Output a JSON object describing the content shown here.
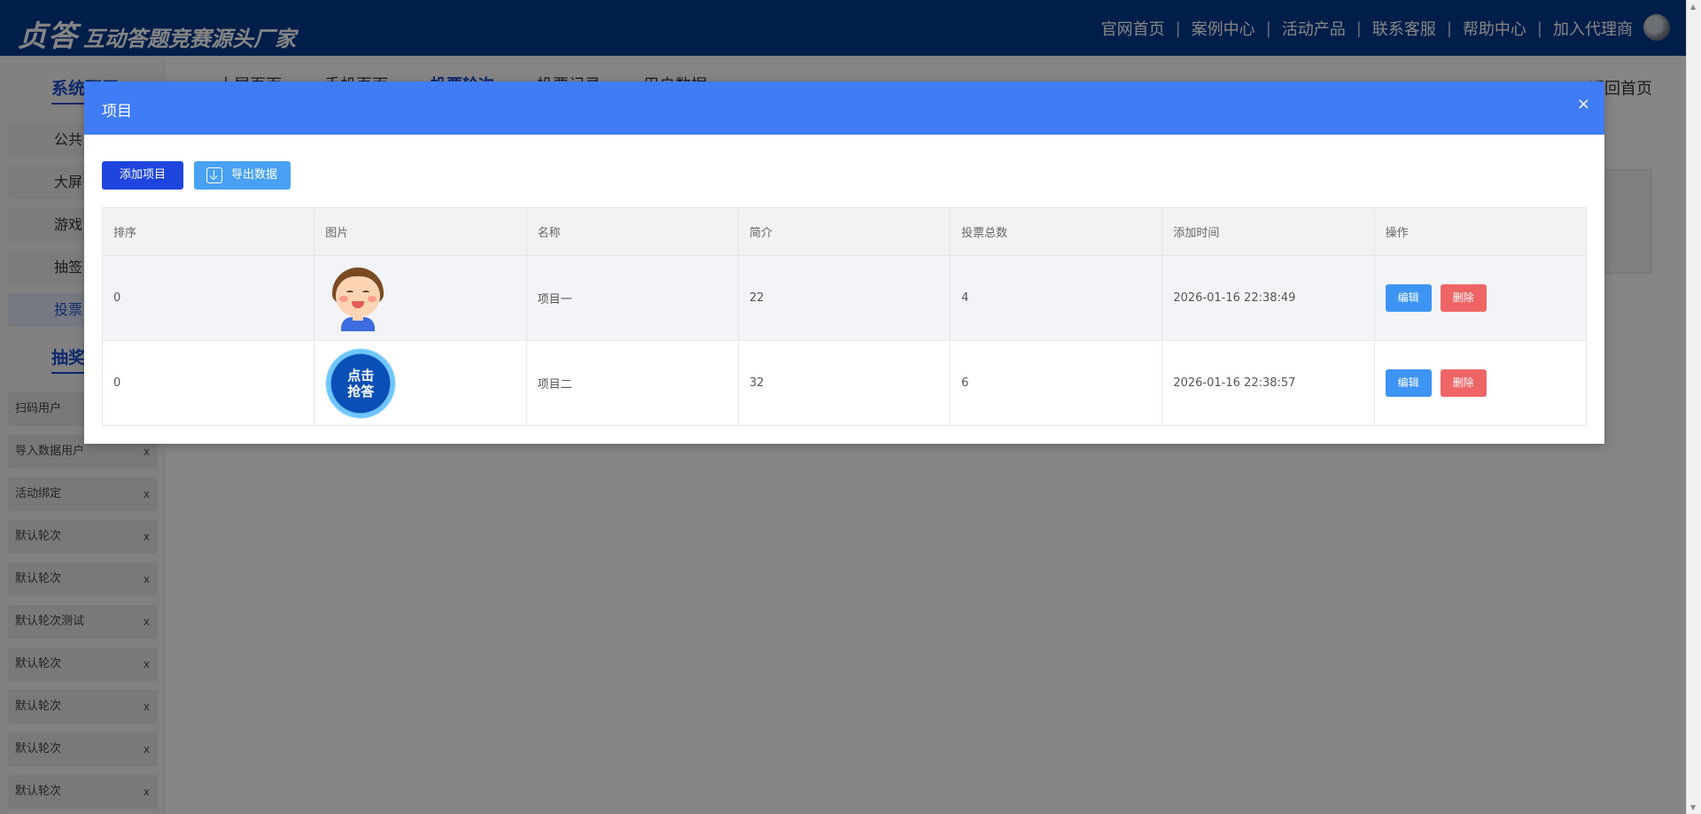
{
  "header": {
    "logo_main": "贞答",
    "logo_sub": "互动答题竞赛源头厂家",
    "nav": [
      "官网首页",
      "案例中心",
      "活动产品",
      "联系客服",
      "帮助中心",
      "加入代理商"
    ],
    "nav_separator": "|"
  },
  "sidebar": {
    "section1_title": "系统配置",
    "menu": [
      "公共",
      "大屏",
      "游戏",
      "抽签",
      "投票"
    ],
    "section2_title": "抽奖",
    "sub_items": [
      {
        "label": "扫码用户",
        "close": ""
      },
      {
        "label": "导入数据用户",
        "close": "x"
      },
      {
        "label": "活动绑定",
        "close": "x"
      },
      {
        "label": "默认轮次",
        "close": "x"
      },
      {
        "label": "默认轮次",
        "close": "x"
      },
      {
        "label": "默认轮次测试",
        "close": "x"
      },
      {
        "label": "默认轮次",
        "close": "x"
      },
      {
        "label": "默认轮次",
        "close": "x"
      },
      {
        "label": "默认轮次",
        "close": "x"
      },
      {
        "label": "默认轮次",
        "close": "x"
      }
    ]
  },
  "main": {
    "tabs": [
      "大屏页面",
      "手机页面",
      "投票轮次",
      "投票记录",
      "用户数据"
    ],
    "back_home": "返回首页"
  },
  "modal": {
    "title": "项目",
    "close": "×",
    "add_button": "添加项目",
    "export_button": "导出数据",
    "columns": [
      "排序",
      "图片",
      "名称",
      "简介",
      "投票总数",
      "添加时间",
      "操作"
    ],
    "rows": [
      {
        "order": "0",
        "image": "cartoon-boy",
        "name": "项目一",
        "intro": "22",
        "votes": "4",
        "time": "2026-01-16 22:38:49",
        "edit": "编辑",
        "delete": "删除"
      },
      {
        "order": "0",
        "image": "click-answer-badge",
        "image_text": "点击抢答",
        "name": "项目二",
        "intro": "32",
        "votes": "6",
        "time": "2026-01-16 22:38:57",
        "edit": "编辑",
        "delete": "删除"
      }
    ]
  },
  "colors": {
    "header": "#033a8f",
    "modal_header": "#3f7cf6",
    "add_button": "#1f45df",
    "export_button": "#48a1f2",
    "edit_button": "#3d94f4",
    "delete_button": "#ef6565",
    "active_accent": "#1b4ecf"
  }
}
